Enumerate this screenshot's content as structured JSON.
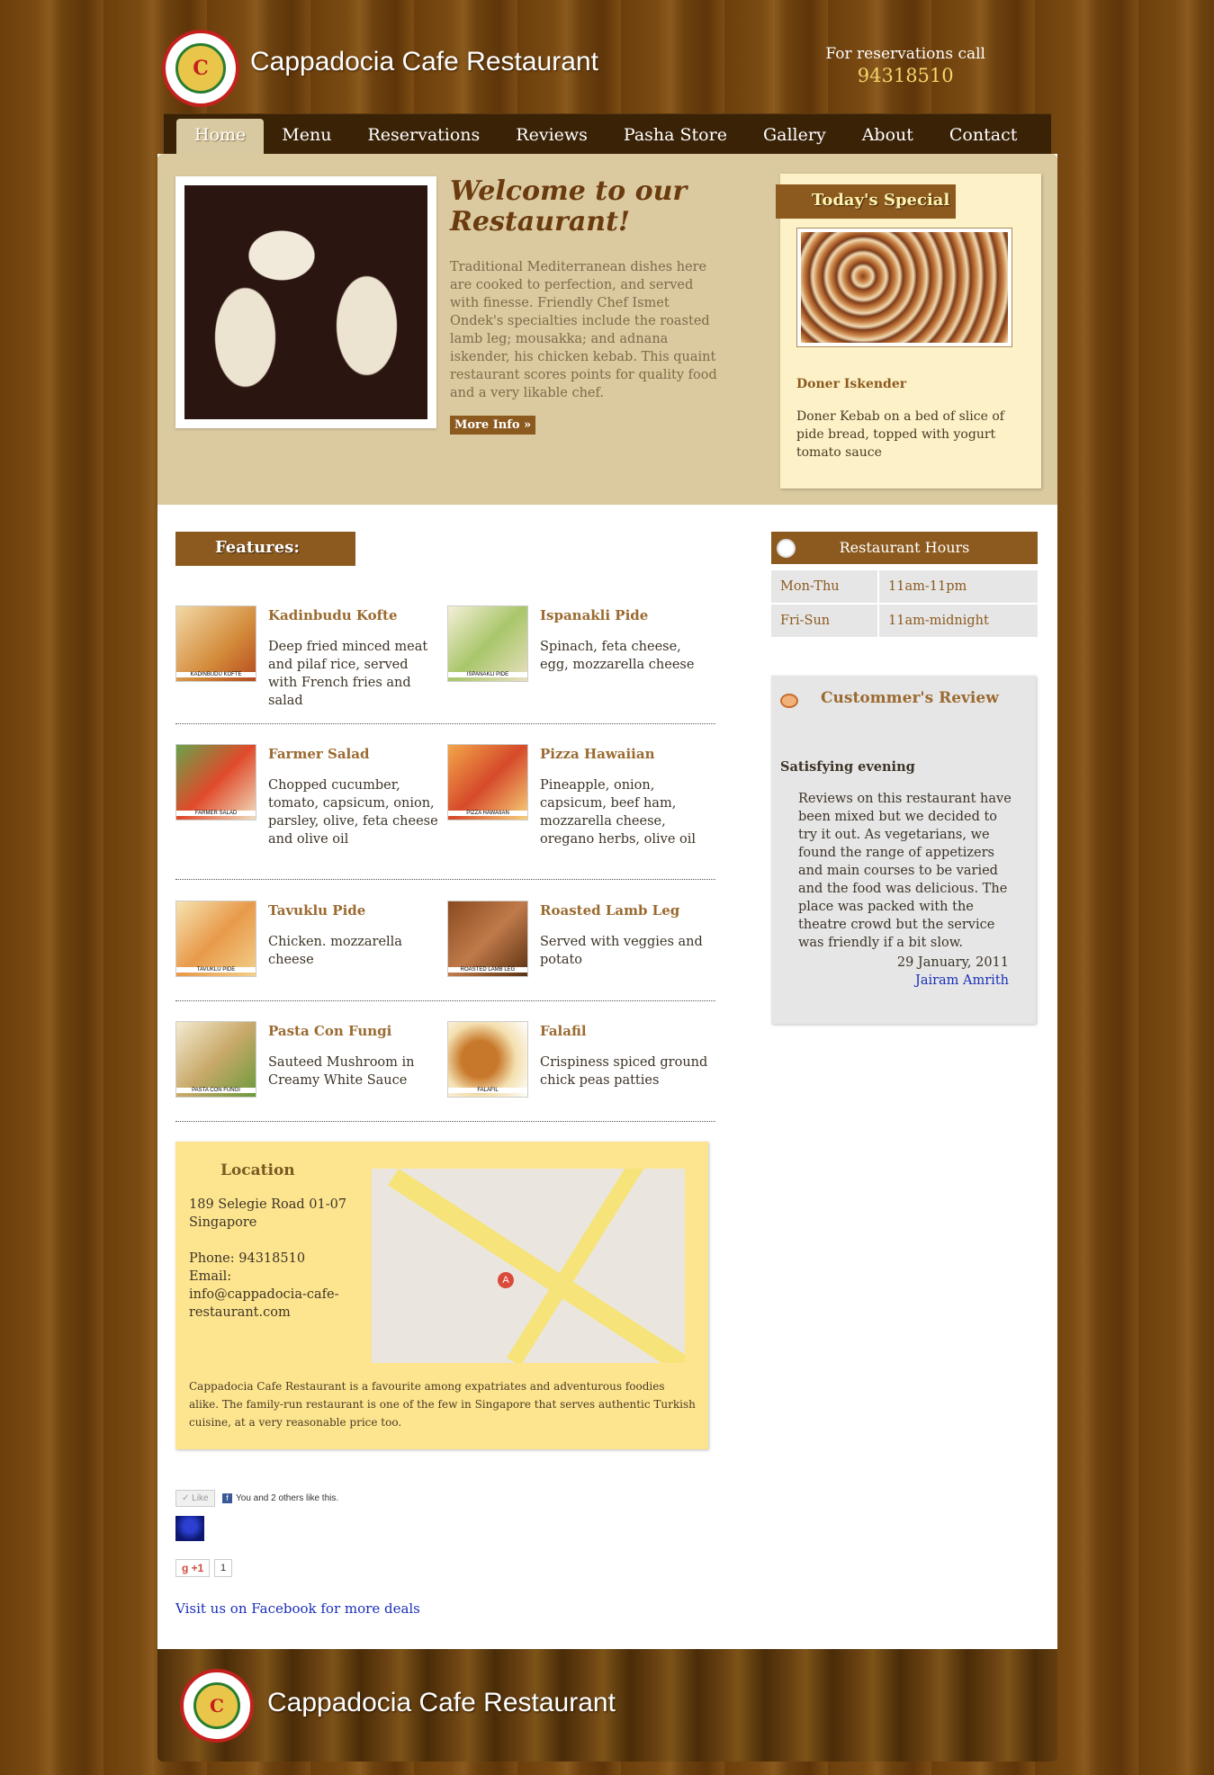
{
  "header": {
    "site_title": "Cappadocia Cafe Restaurant",
    "logo_glyph": "C",
    "reservation_label": "For reservations call",
    "reservation_phone": "94318510"
  },
  "nav": {
    "items": [
      "Home",
      "Menu",
      "Reservations",
      "Reviews",
      "Pasha Store",
      "Gallery",
      "About",
      "Contact"
    ],
    "active": "Home"
  },
  "intro": {
    "title": "Welcome to our Restaurant!",
    "text": "Traditional Mediterranean dishes here are cooked to perfection, and served with finesse. Friendly Chef Ismet Ondek's specialties include the roasted lamb leg; mousakka; and adnana iskender, his chicken kebab. This quaint restaurant scores points for quality food and a very likable chef.",
    "more_info": "More Info »"
  },
  "special": {
    "heading": "Today's Special",
    "name": "Doner Iskender",
    "description": "Doner Kebab on a bed of slice of pide bread, topped with yogurt tomato sauce"
  },
  "features": {
    "heading": "Features:",
    "items": [
      {
        "name": "Kadinbudu Kofte",
        "desc": "Deep fried minced meat and pilaf rice, served with French fries and salad",
        "thumb_label": "KADINBUDU KOFTE"
      },
      {
        "name": "Ispanakli Pide",
        "desc": "Spinach, feta cheese, egg, mozzarella cheese",
        "thumb_label": "ISPANAKLI PIDE"
      },
      {
        "name": "Farmer Salad",
        "desc": "Chopped cucumber, tomato, capsicum, onion, parsley, olive, feta cheese and olive oil",
        "thumb_label": "FARMER SALAD"
      },
      {
        "name": "Pizza Hawaiian",
        "desc": "Pineapple, onion, capsicum, beef ham, mozzarella cheese, oregano herbs, olive oil",
        "thumb_label": "PIZZA HAWAIIAN"
      },
      {
        "name": "Tavuklu Pide",
        "desc": "Chicken. mozzarella cheese",
        "thumb_label": "TAVUKLU PIDE"
      },
      {
        "name": "Roasted Lamb Leg",
        "desc": "Served with veggies and potato",
        "thumb_label": "ROASTED LAMB LEG"
      },
      {
        "name": "Pasta Con Fungi",
        "desc": "Sauteed Mushroom in Creamy White Sauce",
        "thumb_label": "PASTA CON FUNGI"
      },
      {
        "name": "Falafil",
        "desc": "Crispiness spiced ground chick peas patties",
        "thumb_label": "FALAFIL"
      }
    ]
  },
  "location": {
    "heading": "Location",
    "address_line1": "189 Selegie Road 01-07",
    "address_line2": "Singapore",
    "phone": "Phone: 94318510",
    "email": "Email: info@cappadocia-cafe-restaurant.com",
    "map_pin": "A",
    "blurb": "Cappadocia Cafe Restaurant is a favourite among expatriates and adventurous foodies alike. The family-run restaurant is one of the few in Singapore that serves authentic Turkish cuisine, at a very reasonable price too."
  },
  "social": {
    "like_label": "✓ Like",
    "fb_icon": "f",
    "like_text": "You and 2 others like this.",
    "gplus_label": "g +1",
    "gplus_count": "1",
    "fb_link": "Visit us on Facebook for more deals"
  },
  "hours": {
    "heading": "Restaurant Hours",
    "rows": [
      {
        "day": "Mon-Thu",
        "time": "11am-11pm"
      },
      {
        "day": "Fri-Sun",
        "time": "11am-midnight"
      }
    ]
  },
  "review": {
    "heading": "Custommer's Review",
    "title": "Satisfying evening",
    "body": "Reviews on this restaurant have been mixed but we decided to try it out. As vegetarians, we found the range of appetizers and main courses to be varied and the food was delicious. The place was packed with the theatre crowd but the service was friendly if a bit slow.",
    "date": "29 January, 2011",
    "author": "Jairam Amrith"
  },
  "footer": {
    "site_title": "Cappadocia Cafe Restaurant"
  },
  "colors": {
    "brand_brown": "#8c5a1f",
    "special_bg": "#fdf1c8",
    "location_bg": "#fde58f",
    "link_blue": "#1a2fb8"
  }
}
